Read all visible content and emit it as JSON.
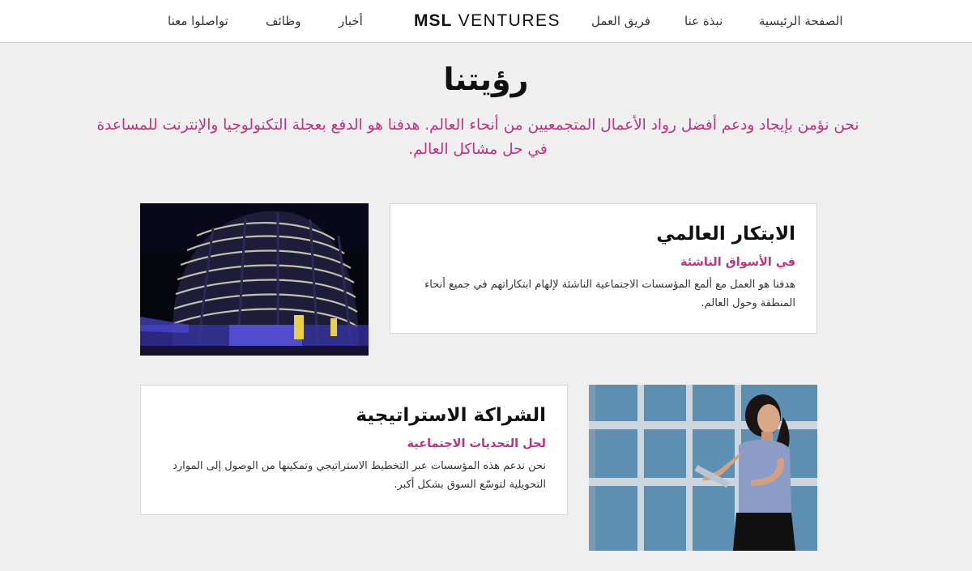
{
  "nav": {
    "brand_bold": "MSL",
    "brand_light": "VENTURES",
    "home": "الصفحة الرئيسية",
    "about": "نبذة عنا",
    "team": "فريق العمل",
    "news": "أخبار",
    "jobs": "وظائف",
    "contact": "تواصلوا معنا"
  },
  "hero": {
    "title": "رؤيتنا",
    "subtitle": "نحن نؤمن بإيجاد ودعم أفضل رواد الأعمال المتجمعيين من أنحاء العالم. هدفنا هو الدفع بعجلة التكنولوجيا والإنترنت للمساعدة في حل مشاكل العالم."
  },
  "cards": [
    {
      "title": "الابتكار العالمي",
      "subtitle": "في الأسواق الناشئة",
      "text": "هدفنا هو العمل مع ألمع المؤسسات الاجتماعية الناشئة لإلهام ابتكاراتهم في جميع أنحاء المنطقة وحول العالم."
    },
    {
      "title": "الشراكة الاستراتيجية",
      "subtitle": "لحل التحديات الاجتماعية",
      "text": "نحن ندعم هذه المؤسسات عبر التخطيط الاستراتيجي وتمكينها من الوصول إلى الموارد التحويلية لتوسّع السوق بشكل أكبر."
    }
  ],
  "colors": {
    "accent": "#c2307f",
    "background": "#efefef",
    "card_bg": "#ffffff"
  }
}
